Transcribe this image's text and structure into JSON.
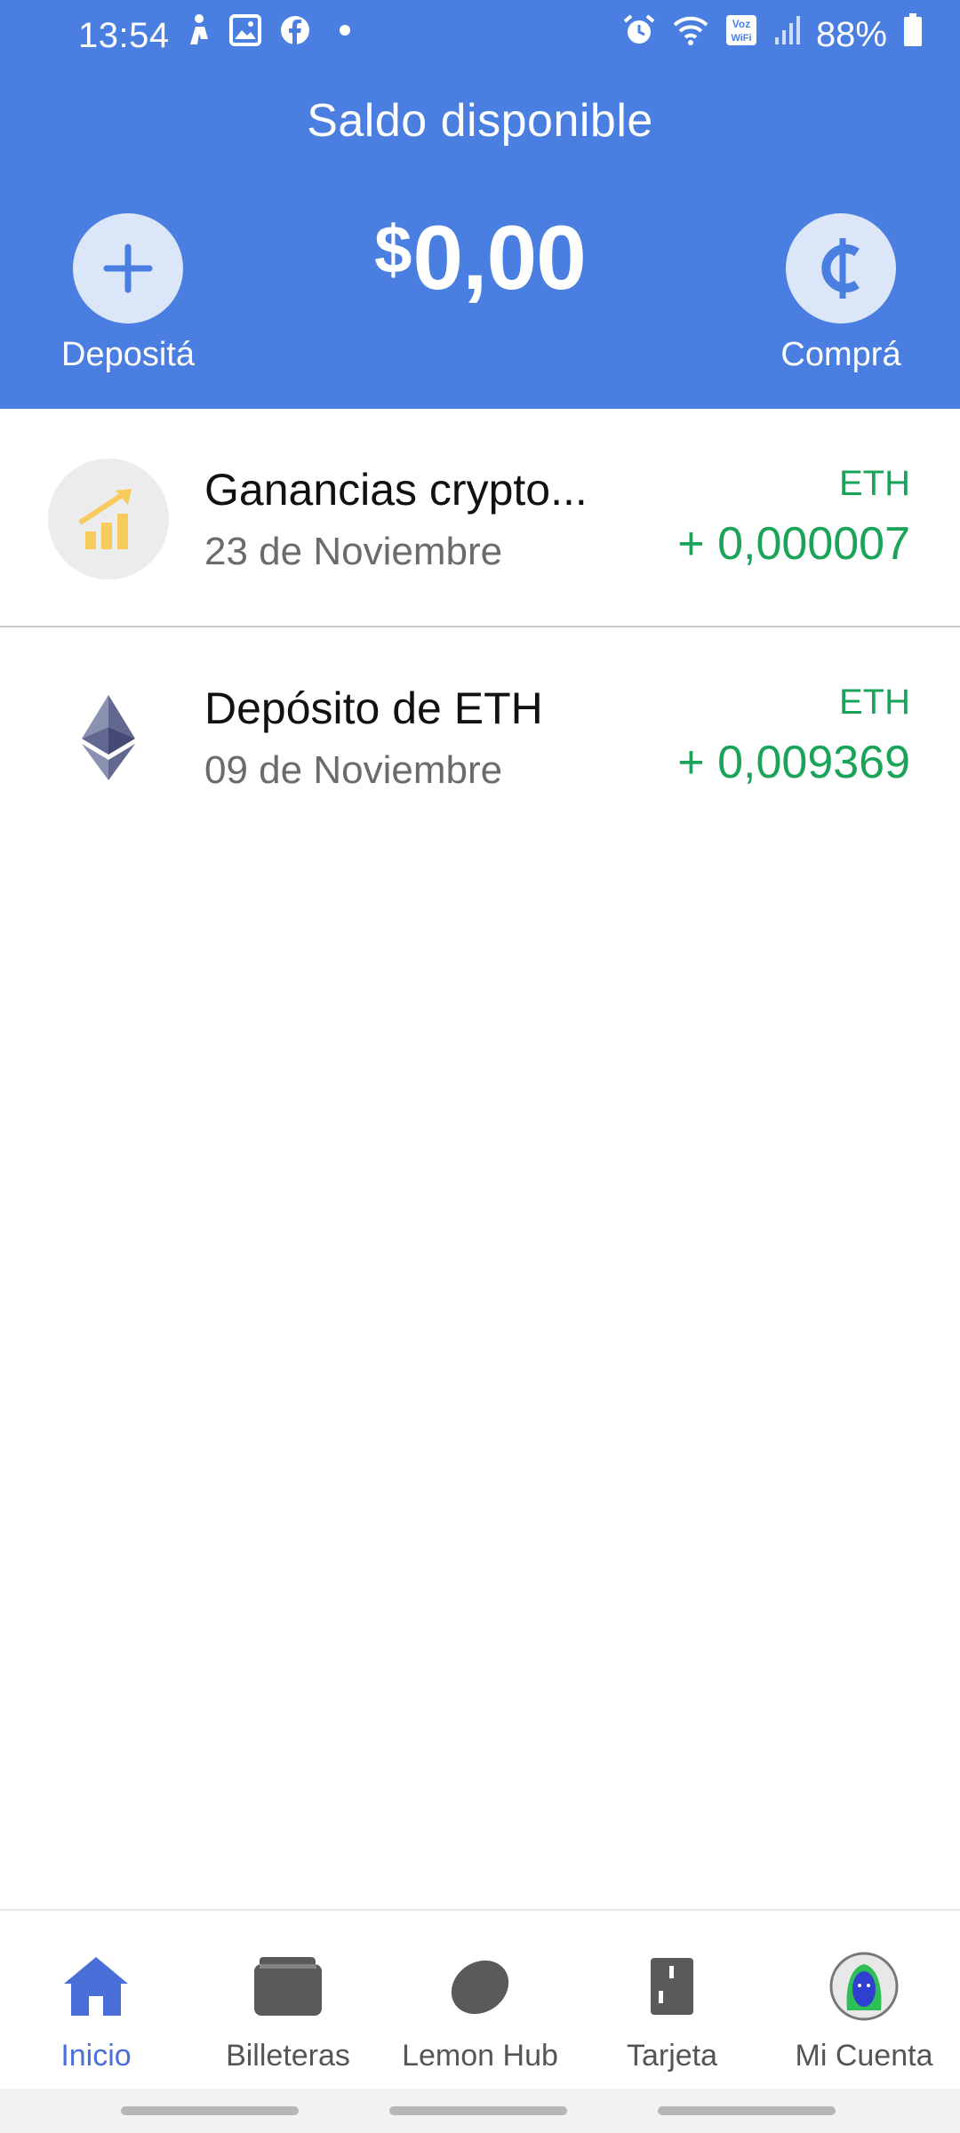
{
  "status_bar": {
    "time": "13:54",
    "battery": "88%",
    "left_icons": [
      "notification-person-icon",
      "gallery-icon",
      "facebook-icon",
      "dot-icon"
    ],
    "right_icons": [
      "alarm-icon",
      "wifi-icon",
      "voz-wifi-icon",
      "signal-icon",
      "battery-icon"
    ],
    "voz_text": "Voz",
    "wifi_text": "WiFi"
  },
  "header": {
    "title": "Saldo disponible",
    "balance_currency": "$",
    "balance_amount": "0,00",
    "deposit_label": "Depositá",
    "buy_label": "Comprá",
    "color": "#4a7fe1"
  },
  "transactions": [
    {
      "title": "Ganancias crypto...",
      "date": "23 de Noviembre",
      "currency": "ETH",
      "amount": "+ 0,000007",
      "icon": "chart-growth-icon"
    },
    {
      "title": "Depósito de ETH",
      "date": "09 de Noviembre",
      "currency": "ETH",
      "amount": "+ 0,009369",
      "icon": "ethereum-icon"
    }
  ],
  "bottom_nav": {
    "items": [
      {
        "label": "Inicio",
        "icon": "home-icon",
        "active": true
      },
      {
        "label": "Billeteras",
        "icon": "wallet-icon",
        "active": false
      },
      {
        "label": "Lemon Hub",
        "icon": "lemon-icon",
        "active": false
      },
      {
        "label": "Tarjeta",
        "icon": "card-icon",
        "active": false
      },
      {
        "label": "Mi Cuenta",
        "icon": "avatar-icon",
        "active": false
      }
    ]
  },
  "colors": {
    "accent": "#4a7fe1",
    "positive": "#1aa45a",
    "nav_active": "#4a6fd8"
  }
}
